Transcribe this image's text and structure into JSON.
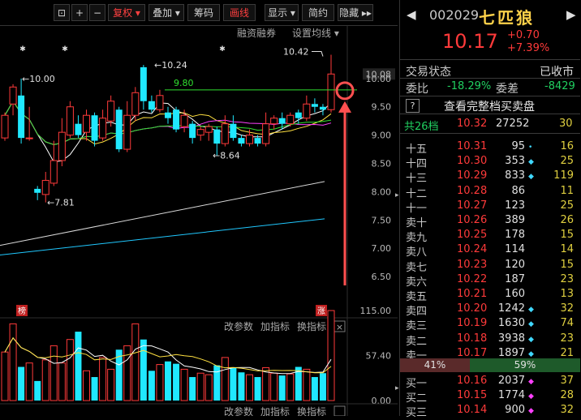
{
  "toolbar": {
    "items": [
      {
        "label": "⊡",
        "name": "screenshot-icon"
      },
      {
        "label": "+",
        "name": "zoom-in-button"
      },
      {
        "label": "−",
        "name": "zoom-out-button"
      },
      {
        "label": "复权 ▾",
        "name": "fuquan-button"
      },
      {
        "label": "叠加 ▾",
        "name": "overlay-button"
      },
      {
        "label": "筹码",
        "name": "chips-button"
      },
      {
        "label": "画线",
        "name": "draw-line-button"
      },
      {
        "label": "显示 ▾",
        "name": "display-button"
      },
      {
        "label": "简约",
        "name": "simple-button"
      },
      {
        "label": "隐藏 ▸▸",
        "name": "hide-button"
      }
    ]
  },
  "chart": {
    "sub_links": [
      "融资融券",
      "设置均线 ▾"
    ],
    "price_axis": [
      "10.08",
      "10.00",
      "9.50",
      "9.00",
      "8.50",
      "8.00",
      "7.50",
      "7.00",
      "6.50"
    ],
    "annotations": [
      "10.42",
      "10.24",
      "10.00",
      "9.80",
      "8.64",
      "7.81"
    ],
    "badges": [
      "榜",
      "涨"
    ],
    "vol_header": [
      "改参数",
      "加指标",
      "换指标"
    ],
    "vol_axis": [
      "115.00",
      "57.40",
      "0.00"
    ],
    "bottom_header": [
      "改参数",
      "加指标",
      "换指标"
    ],
    "close_glyph": "×"
  },
  "chart_data": {
    "type": "candlestick",
    "candles": [
      {
        "o": 8.95,
        "c": 9.35,
        "h": 9.4,
        "l": 8.9
      },
      {
        "o": 9.55,
        "c": 9.85,
        "h": 9.9,
        "l": 9.35
      },
      {
        "o": 9.7,
        "c": 8.95,
        "h": 10.0,
        "l": 8.85
      },
      {
        "o": 8.95,
        "c": 8.95,
        "h": 9.5,
        "l": 8.9
      },
      {
        "o": 8.05,
        "c": 7.98,
        "h": 8.1,
        "l": 7.85
      },
      {
        "o": 7.95,
        "c": 8.2,
        "h": 8.35,
        "l": 7.81
      },
      {
        "o": 8.15,
        "c": 8.55,
        "h": 8.9,
        "l": 8.1
      },
      {
        "o": 8.55,
        "c": 9.05,
        "h": 9.3,
        "l": 8.45
      },
      {
        "o": 9.0,
        "c": 9.5,
        "h": 9.6,
        "l": 8.95
      },
      {
        "o": 9.2,
        "c": 9.0,
        "h": 9.35,
        "l": 8.95
      },
      {
        "o": 9.05,
        "c": 9.35,
        "h": 9.45,
        "l": 8.9
      },
      {
        "o": 9.35,
        "c": 8.9,
        "h": 9.4,
        "l": 8.8
      },
      {
        "o": 8.95,
        "c": 9.3,
        "h": 9.45,
        "l": 8.9
      },
      {
        "o": 9.25,
        "c": 9.6,
        "h": 9.7,
        "l": 9.15
      },
      {
        "o": 9.45,
        "c": 8.75,
        "h": 9.5,
        "l": 8.7
      },
      {
        "o": 8.75,
        "c": 9.35,
        "h": 9.6,
        "l": 8.7
      },
      {
        "o": 9.35,
        "c": 9.75,
        "h": 9.85,
        "l": 9.25
      },
      {
        "o": 10.2,
        "c": 9.6,
        "h": 10.24,
        "l": 9.45
      },
      {
        "o": 9.6,
        "c": 9.45,
        "h": 9.7,
        "l": 9.4
      },
      {
        "o": 9.45,
        "c": 9.7,
        "h": 9.8,
        "l": 9.4
      },
      {
        "o": 9.4,
        "c": 9.3,
        "h": 9.5,
        "l": 9.2
      },
      {
        "o": 9.45,
        "c": 9.1,
        "h": 9.5,
        "l": 9.05
      },
      {
        "o": 9.15,
        "c": 9.35,
        "h": 9.45,
        "l": 9.05
      },
      {
        "o": 9.2,
        "c": 8.95,
        "h": 9.25,
        "l": 8.85
      },
      {
        "o": 9.0,
        "c": 9.1,
        "h": 9.15,
        "l": 8.9
      },
      {
        "o": 9.05,
        "c": 9.15,
        "h": 9.2,
        "l": 8.9
      },
      {
        "o": 9.1,
        "c": 8.85,
        "h": 9.15,
        "l": 8.64
      },
      {
        "o": 8.85,
        "c": 9.2,
        "h": 9.35,
        "l": 8.8
      },
      {
        "o": 9.2,
        "c": 8.95,
        "h": 9.35,
        "l": 8.9
      },
      {
        "o": 8.95,
        "c": 8.85,
        "h": 9.0,
        "l": 8.8
      },
      {
        "o": 8.85,
        "c": 9.0,
        "h": 9.1,
        "l": 8.8
      },
      {
        "o": 8.95,
        "c": 8.85,
        "h": 9.0,
        "l": 8.8
      },
      {
        "o": 8.85,
        "c": 9.2,
        "h": 9.4,
        "l": 8.8
      },
      {
        "o": 9.2,
        "c": 9.3,
        "h": 9.35,
        "l": 9.1
      },
      {
        "o": 9.3,
        "c": 9.2,
        "h": 9.4,
        "l": 9.1
      },
      {
        "o": 9.2,
        "c": 9.35,
        "h": 9.4,
        "l": 9.15
      },
      {
        "o": 9.4,
        "c": 9.3,
        "h": 9.45,
        "l": 9.2
      },
      {
        "o": 9.3,
        "c": 9.55,
        "h": 9.7,
        "l": 9.25
      },
      {
        "o": 9.55,
        "c": 9.5,
        "h": 9.65,
        "l": 9.4
      },
      {
        "o": 9.5,
        "c": 9.45,
        "h": 9.55,
        "l": 9.35
      },
      {
        "o": 9.45,
        "c": 10.08,
        "h": 10.42,
        "l": 9.4
      }
    ],
    "volume": [
      62,
      98,
      43,
      48,
      25,
      52,
      70,
      48,
      78,
      88,
      38,
      30,
      55,
      40,
      65,
      70,
      98,
      78,
      38,
      46,
      50,
      47,
      40,
      30,
      35,
      33,
      45,
      55,
      42,
      36,
      33,
      30,
      42,
      35,
      32,
      34,
      43,
      40,
      30,
      35,
      115
    ],
    "y_range": [
      6.3,
      10.6
    ],
    "vol_range": [
      0,
      115
    ],
    "marked_line": 9.8
  },
  "panel": {
    "code": "002029",
    "name": "七匹狼",
    "price": "10.17",
    "change": "+0.70",
    "change_pct": "+7.39%",
    "status_label": "交易状态",
    "status_value": "已收市",
    "weibi_label": "委比",
    "weibi_value": "-18.29%",
    "weicha_label": "委差",
    "weicha_value": "-8429",
    "q_icon": "?",
    "full_book_label": "查看完整档买卖盘",
    "total_label": "共26档",
    "total_price": "10.32",
    "total_vol": "27252",
    "total_cnt": "30",
    "asks": [
      {
        "label": "十五",
        "price": "10.31",
        "vol": "95",
        "mark": "dot",
        "cnt": "16"
      },
      {
        "label": "十四",
        "price": "10.30",
        "vol": "353",
        "mark": "diamond",
        "cnt": "25"
      },
      {
        "label": "十三",
        "price": "10.29",
        "vol": "833",
        "mark": "diamond",
        "cnt": "119"
      },
      {
        "label": "十二",
        "price": "10.28",
        "vol": "86",
        "mark": "",
        "cnt": "11"
      },
      {
        "label": "十一",
        "price": "10.27",
        "vol": "123",
        "mark": "",
        "cnt": "25"
      },
      {
        "label": "卖十",
        "price": "10.26",
        "vol": "389",
        "mark": "",
        "cnt": "26"
      },
      {
        "label": "卖九",
        "price": "10.25",
        "vol": "178",
        "mark": "",
        "cnt": "15"
      },
      {
        "label": "卖八",
        "price": "10.24",
        "vol": "114",
        "mark": "",
        "cnt": "14"
      },
      {
        "label": "卖七",
        "price": "10.23",
        "vol": "120",
        "mark": "",
        "cnt": "15"
      },
      {
        "label": "卖六",
        "price": "10.22",
        "vol": "187",
        "mark": "",
        "cnt": "23"
      },
      {
        "label": "卖五",
        "price": "10.21",
        "vol": "160",
        "mark": "",
        "cnt": "13"
      },
      {
        "label": "卖四",
        "price": "10.20",
        "vol": "1242",
        "mark": "diamond",
        "cnt": "32"
      },
      {
        "label": "卖三",
        "price": "10.19",
        "vol": "1630",
        "mark": "diamond",
        "cnt": "74"
      },
      {
        "label": "卖二",
        "price": "10.18",
        "vol": "3938",
        "mark": "diamond",
        "cnt": "23"
      },
      {
        "label": "卖一",
        "price": "10.17",
        "vol": "1897",
        "mark": "diamond",
        "cnt": "21"
      }
    ],
    "ratio_left": "41%",
    "ratio_right": "59%",
    "bids": [
      {
        "label": "买一",
        "price": "10.16",
        "vol": "2037",
        "mark": "diamond-m",
        "cnt": "37"
      },
      {
        "label": "买二",
        "price": "10.15",
        "vol": "1774",
        "mark": "diamond-m",
        "cnt": "28"
      },
      {
        "label": "买三",
        "price": "10.14",
        "vol": "900",
        "mark": "diamond-m",
        "cnt": "32"
      }
    ],
    "colors": {
      "up": "#ff3a3a",
      "down": "#40e0ff",
      "green": "#20d060",
      "yellow": "#e0d040"
    }
  }
}
